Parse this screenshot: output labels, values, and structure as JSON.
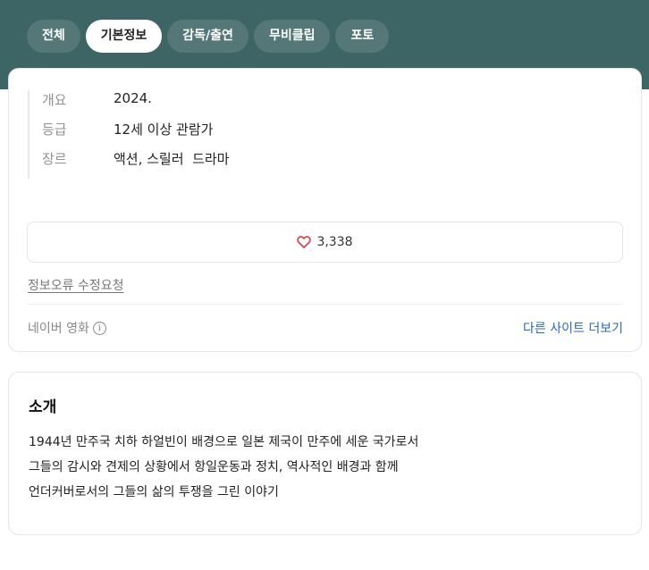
{
  "tabs": [
    {
      "label": "전체",
      "active": false
    },
    {
      "label": "기본정보",
      "active": true
    },
    {
      "label": "감독/출연",
      "active": false
    },
    {
      "label": "무비클립",
      "active": false
    },
    {
      "label": "포토",
      "active": false
    }
  ],
  "info": {
    "rows": [
      {
        "label": "개요",
        "value": "2024."
      },
      {
        "label": "등급",
        "value": "12세 이상 관람가"
      },
      {
        "label": "장르",
        "value": "액션, 스릴러  드라마"
      }
    ]
  },
  "like": {
    "count": "3,338",
    "icon": "heart-outline-icon",
    "color": "#e0363b"
  },
  "links": {
    "error_report": "정보오류 수정요청",
    "source": "네이버 영화",
    "more_sites": "다른 사이트 더보기"
  },
  "intro": {
    "title": "소개",
    "lines": [
      "1944년 만주국 치하 하얼빈이 배경으로 일본 제국이 만주에 세운 국가로서",
      "그들의 감시와 견제의 상황에서 항일운동과 정치, 역사적인 배경과 함께",
      "언더커버로서의 그들의 삶의 투쟁을 그린 이야기"
    ]
  },
  "colors": {
    "header": "#3d6565",
    "link": "#2a6ab8"
  }
}
